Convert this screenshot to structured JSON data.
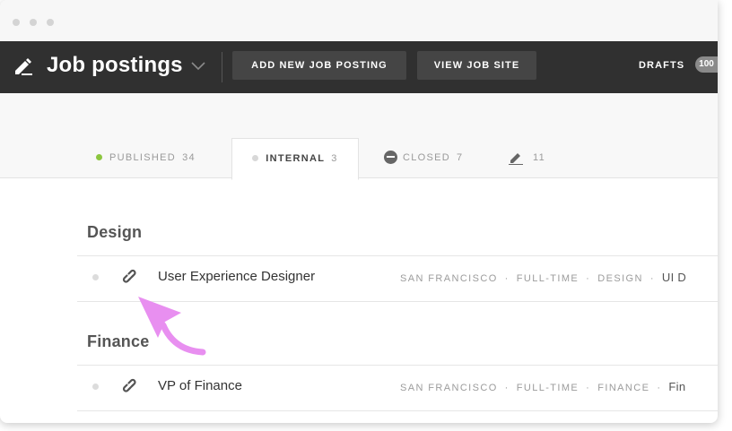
{
  "app": {
    "title": "Job postings"
  },
  "toolbar": {
    "add_label": "ADD NEW JOB POSTING",
    "view_label": "VIEW JOB SITE",
    "drafts_label": "DRAFTS",
    "drafts_count": "100"
  },
  "tabs": [
    {
      "label": "PUBLISHED",
      "count": "34",
      "dot_color": "#8cc63f"
    },
    {
      "label": "INTERNAL",
      "count": "3",
      "dot_color": "#d8d8d8"
    },
    {
      "label": "CLOSED",
      "count": "7"
    },
    {
      "count": "11",
      "icon": "pencil-icon"
    }
  ],
  "sections": [
    {
      "title": "Design",
      "rows": [
        {
          "title": "User Experience Designer",
          "location": "SAN FRANCISCO",
          "type": "FULL-TIME",
          "department": "DESIGN",
          "team": "UI D"
        }
      ]
    },
    {
      "title": "Finance",
      "rows": [
        {
          "title": "VP of Finance",
          "location": "SAN FRANCISCO",
          "type": "FULL-TIME",
          "department": "FINANCE",
          "team": "Fin"
        }
      ]
    }
  ],
  "meta_separator": "·",
  "colors": {
    "appbar": "#303030",
    "accent_green": "#8cc63f",
    "annotation_arrow": "#e88ff0"
  },
  "annotation": {
    "icon": "arrow-annotation-icon"
  }
}
